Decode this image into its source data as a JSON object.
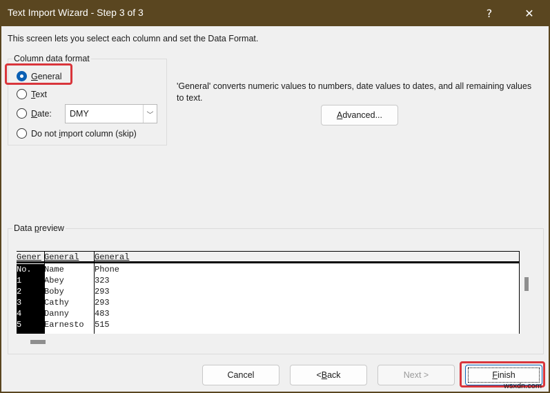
{
  "window": {
    "title": "Text Import Wizard - Step 3 of 3",
    "help_label": "?",
    "close_label": "✕"
  },
  "intro": "This screen lets you select each column and set the Data Format.",
  "column_format": {
    "legend": "Column data format",
    "options": [
      {
        "label_u": "G",
        "label_rest": "eneral",
        "checked": true
      },
      {
        "label_u": "T",
        "label_rest": "ext",
        "checked": false
      },
      {
        "label_u": "D",
        "label_rest": "ate:",
        "checked": false
      },
      {
        "label_pre": "Do not ",
        "label_u": "i",
        "label_rest": "mport column (skip)",
        "checked": false
      }
    ],
    "date_value": "DMY",
    "date_arrow": "﹀"
  },
  "description": "'General' converts numeric values to numbers, date values to dates, and all remaining values to text.",
  "advanced_button": {
    "u": "A",
    "rest": "dvanced..."
  },
  "preview": {
    "legend_pre": "Data ",
    "legend_u": "p",
    "legend_rest": "review",
    "headers": [
      "Gener",
      "General",
      "General"
    ],
    "columns": [
      [
        "No.",
        "1",
        "2",
        "3",
        "4",
        "5"
      ],
      [
        "Name",
        "Abey",
        "Boby",
        "Cathy",
        "Danny",
        "Earnesto"
      ],
      [
        "Phone",
        "323",
        "293",
        "293",
        "483",
        "515"
      ]
    ]
  },
  "buttons": {
    "cancel": "Cancel",
    "back_pre": "< ",
    "back_u": "B",
    "back_rest": "ack",
    "next": "Next >",
    "finish_u": "F",
    "finish_rest": "inish"
  },
  "watermark": "wsxdn.com"
}
